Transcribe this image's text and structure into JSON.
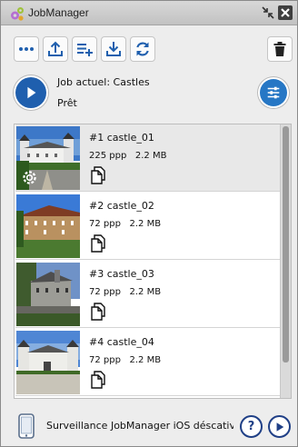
{
  "window": {
    "title": "JobManager"
  },
  "toolbar": {
    "buttons": [
      {
        "name": "more",
        "icon": "ellipsis-icon"
      },
      {
        "name": "upload",
        "icon": "upload-icon"
      },
      {
        "name": "add-list",
        "icon": "list-add-icon"
      },
      {
        "name": "download",
        "icon": "download-icon"
      },
      {
        "name": "refresh",
        "icon": "refresh-icon"
      },
      {
        "name": "delete",
        "icon": "trash-icon"
      }
    ]
  },
  "job": {
    "label": "Job actuel: Castles",
    "status": "Prêt"
  },
  "items": [
    {
      "title": "#1 castle_01",
      "ppi": "225 ppp",
      "size": "2.2 MB",
      "selected": true
    },
    {
      "title": "#2 castle_02",
      "ppi": "72 ppp",
      "size": "2.2 MB",
      "selected": false
    },
    {
      "title": "#3 castle_03",
      "ppi": "72 ppp",
      "size": "2.2 MB",
      "selected": false
    },
    {
      "title": "#4 castle_04",
      "ppi": "72 ppp",
      "size": "2.2 MB",
      "selected": false
    }
  ],
  "footer": {
    "text": "Surveillance JobManager iOS déscativ"
  },
  "colors": {
    "accent": "#1f5fae",
    "settings": "#2677c5",
    "footer_btn": "#1f3f86"
  }
}
